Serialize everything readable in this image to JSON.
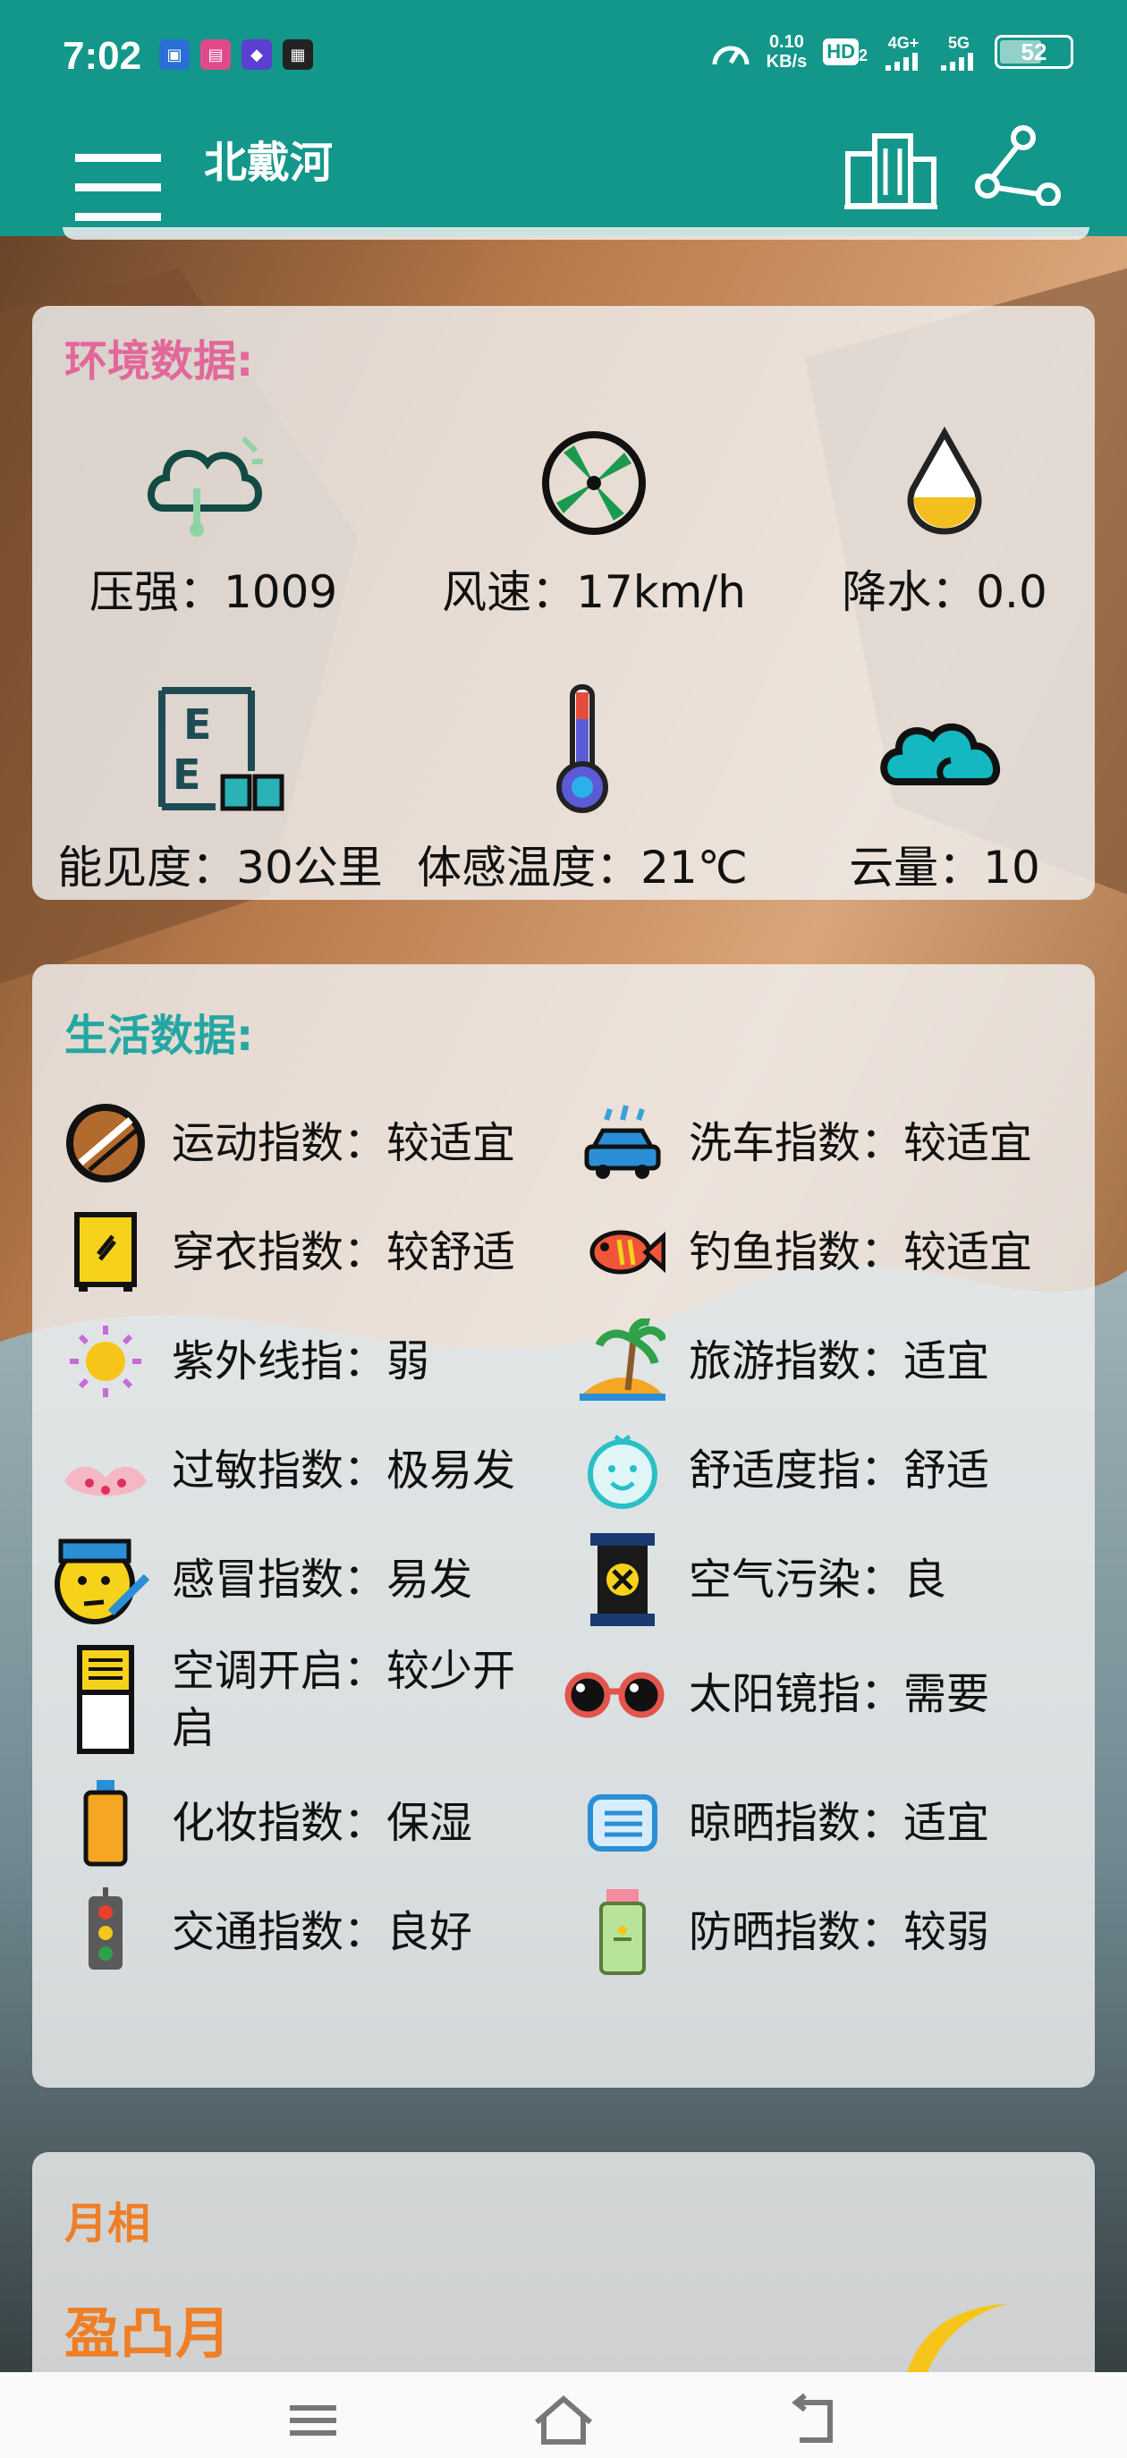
{
  "status_bar": {
    "time": "7:02",
    "network_speed_value": "0.10",
    "network_speed_unit": "KB/s",
    "hd_label": "HD",
    "sim2_label": "2",
    "net_4g": "4G+",
    "net_5g": "5G",
    "battery_level": "52"
  },
  "app_bar": {
    "title": "北戴河"
  },
  "environment": {
    "title": "环境数据:",
    "items": [
      {
        "label": "压强：1009",
        "icon": "cloud-pressure-icon"
      },
      {
        "label": "风速：17km/h",
        "icon": "fan-icon"
      },
      {
        "label": "降水：0.0",
        "icon": "raindrop-icon"
      },
      {
        "label": "能见度：30公里",
        "icon": "eye-chart-icon"
      },
      {
        "label": "体感温度：21℃",
        "icon": "thermometer-icon"
      },
      {
        "label": "云量：10",
        "icon": "cloud-icon"
      }
    ]
  },
  "life": {
    "title": "生活数据:",
    "items": [
      {
        "label": "运动指数：较适宜",
        "icon": "sport-ball-icon"
      },
      {
        "label": "洗车指数：较适宜",
        "icon": "car-wash-icon"
      },
      {
        "label": "穿衣指数：较舒适",
        "icon": "wardrobe-icon"
      },
      {
        "label": "钓鱼指数：较适宜",
        "icon": "fish-icon"
      },
      {
        "label": "紫外线指：弱",
        "icon": "sun-icon"
      },
      {
        "label": "旅游指数：适宜",
        "icon": "palm-island-icon"
      },
      {
        "label": "过敏指数：极易发",
        "icon": "allergy-icon"
      },
      {
        "label": "舒适度指：舒适",
        "icon": "smiley-face-icon"
      },
      {
        "label": "感冒指数：易发",
        "icon": "sick-face-icon"
      },
      {
        "label": "空气污染：良",
        "icon": "air-pollution-icon"
      },
      {
        "label_line1": "空调开启：较少开",
        "label_line2": "启",
        "icon": "air-conditioner-icon"
      },
      {
        "label": "太阳镜指：需要",
        "icon": "sunglasses-icon"
      },
      {
        "label": "化妆指数：保湿",
        "icon": "cosmetic-bottle-icon"
      },
      {
        "label": "晾晒指数：适宜",
        "icon": "drying-icon"
      },
      {
        "label": "交通指数：良好",
        "icon": "traffic-light-icon"
      },
      {
        "label": "防晒指数：较弱",
        "icon": "sunscreen-icon"
      }
    ]
  },
  "moon": {
    "title": "月相",
    "phase": "盈凸月"
  },
  "colors": {
    "primary": "#13978a",
    "env_title": "#e3679a",
    "life_title": "#24a7a2",
    "moon_title": "#ef7f26"
  }
}
